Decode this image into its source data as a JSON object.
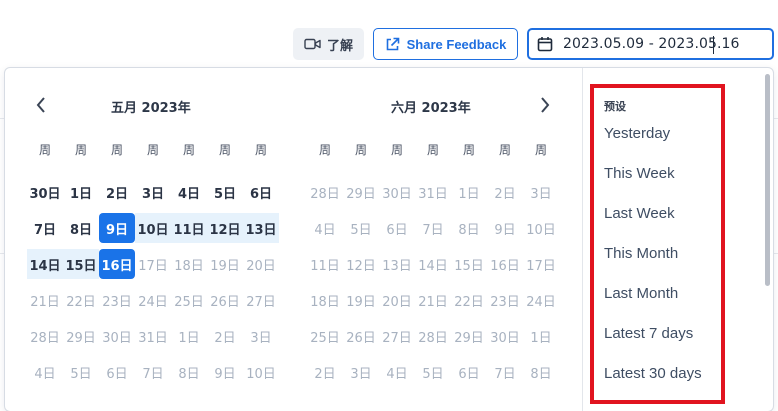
{
  "toolbar": {
    "learn_label": "了解",
    "share_label": "Share Feedback",
    "date_range": "2023.05.09 - 2023.05.16"
  },
  "calendar": {
    "weekday_label": "周",
    "months": [
      {
        "title": "五月  2023年",
        "weeks": [
          [
            {
              "d": "30日",
              "m": 0
            },
            {
              "d": "1日",
              "m": 0
            },
            {
              "d": "2日",
              "m": 0
            },
            {
              "d": "3日",
              "m": 0
            },
            {
              "d": "4日",
              "m": 0
            },
            {
              "d": "5日",
              "m": 0
            },
            {
              "d": "6日",
              "m": 0
            }
          ],
          [
            {
              "d": "7日",
              "m": 0
            },
            {
              "d": "8日",
              "m": 0
            },
            {
              "d": "9日",
              "s": 1
            },
            {
              "d": "10日",
              "r": 1
            },
            {
              "d": "11日",
              "r": 1
            },
            {
              "d": "12日",
              "r": 1
            },
            {
              "d": "13日",
              "r": 1
            }
          ],
          [
            {
              "d": "14日",
              "r": 1
            },
            {
              "d": "15日",
              "r": 1
            },
            {
              "d": "16日",
              "s": 1
            },
            {
              "d": "17日",
              "m": 1
            },
            {
              "d": "18日",
              "m": 1
            },
            {
              "d": "19日",
              "m": 1
            },
            {
              "d": "20日",
              "m": 1
            }
          ],
          [
            {
              "d": "21日",
              "m": 1
            },
            {
              "d": "22日",
              "m": 1
            },
            {
              "d": "23日",
              "m": 1
            },
            {
              "d": "24日",
              "m": 1
            },
            {
              "d": "25日",
              "m": 1
            },
            {
              "d": "26日",
              "m": 1
            },
            {
              "d": "27日",
              "m": 1
            }
          ],
          [
            {
              "d": "28日",
              "m": 1
            },
            {
              "d": "29日",
              "m": 1
            },
            {
              "d": "30日",
              "m": 1
            },
            {
              "d": "31日",
              "m": 1
            },
            {
              "d": "1日",
              "m": 1
            },
            {
              "d": "2日",
              "m": 1
            },
            {
              "d": "3日",
              "m": 1
            }
          ],
          [
            {
              "d": "4日",
              "m": 1
            },
            {
              "d": "5日",
              "m": 1
            },
            {
              "d": "6日",
              "m": 1
            },
            {
              "d": "7日",
              "m": 1
            },
            {
              "d": "8日",
              "m": 1
            },
            {
              "d": "9日",
              "m": 1
            },
            {
              "d": "10日",
              "m": 1
            }
          ]
        ]
      },
      {
        "title": "六月  2023年",
        "weeks": [
          [
            {
              "d": "28日",
              "m": 1
            },
            {
              "d": "29日",
              "m": 1
            },
            {
              "d": "30日",
              "m": 1
            },
            {
              "d": "31日",
              "m": 1
            },
            {
              "d": "1日",
              "m": 1
            },
            {
              "d": "2日",
              "m": 1
            },
            {
              "d": "3日",
              "m": 1
            }
          ],
          [
            {
              "d": "4日",
              "m": 1
            },
            {
              "d": "5日",
              "m": 1
            },
            {
              "d": "6日",
              "m": 1
            },
            {
              "d": "7日",
              "m": 1
            },
            {
              "d": "8日",
              "m": 1
            },
            {
              "d": "9日",
              "m": 1
            },
            {
              "d": "10日",
              "m": 1
            }
          ],
          [
            {
              "d": "11日",
              "m": 1
            },
            {
              "d": "12日",
              "m": 1
            },
            {
              "d": "13日",
              "m": 1
            },
            {
              "d": "14日",
              "m": 1
            },
            {
              "d": "15日",
              "m": 1
            },
            {
              "d": "16日",
              "m": 1
            },
            {
              "d": "17日",
              "m": 1
            }
          ],
          [
            {
              "d": "18日",
              "m": 1
            },
            {
              "d": "19日",
              "m": 1
            },
            {
              "d": "20日",
              "m": 1
            },
            {
              "d": "21日",
              "m": 1
            },
            {
              "d": "22日",
              "m": 1
            },
            {
              "d": "23日",
              "m": 1
            },
            {
              "d": "24日",
              "m": 1
            }
          ],
          [
            {
              "d": "25日",
              "m": 1
            },
            {
              "d": "26日",
              "m": 1
            },
            {
              "d": "27日",
              "m": 1
            },
            {
              "d": "28日",
              "m": 1
            },
            {
              "d": "29日",
              "m": 1
            },
            {
              "d": "30日",
              "m": 1
            },
            {
              "d": "1日",
              "m": 1
            }
          ],
          [
            {
              "d": "2日",
              "m": 1
            },
            {
              "d": "3日",
              "m": 1
            },
            {
              "d": "4日",
              "m": 1
            },
            {
              "d": "5日",
              "m": 1
            },
            {
              "d": "6日",
              "m": 1
            },
            {
              "d": "7日",
              "m": 1
            },
            {
              "d": "8日",
              "m": 1
            }
          ]
        ]
      }
    ]
  },
  "presets": {
    "title": "预设",
    "items": [
      "Yesterday",
      "This Week",
      "Last Week",
      "This Month",
      "Last Month",
      "Latest 7 days",
      "Latest 30 days"
    ]
  },
  "colors": {
    "accent": "#1a73e8",
    "range_bg": "#e6f2fc",
    "highlight_box": "#e1141f"
  }
}
